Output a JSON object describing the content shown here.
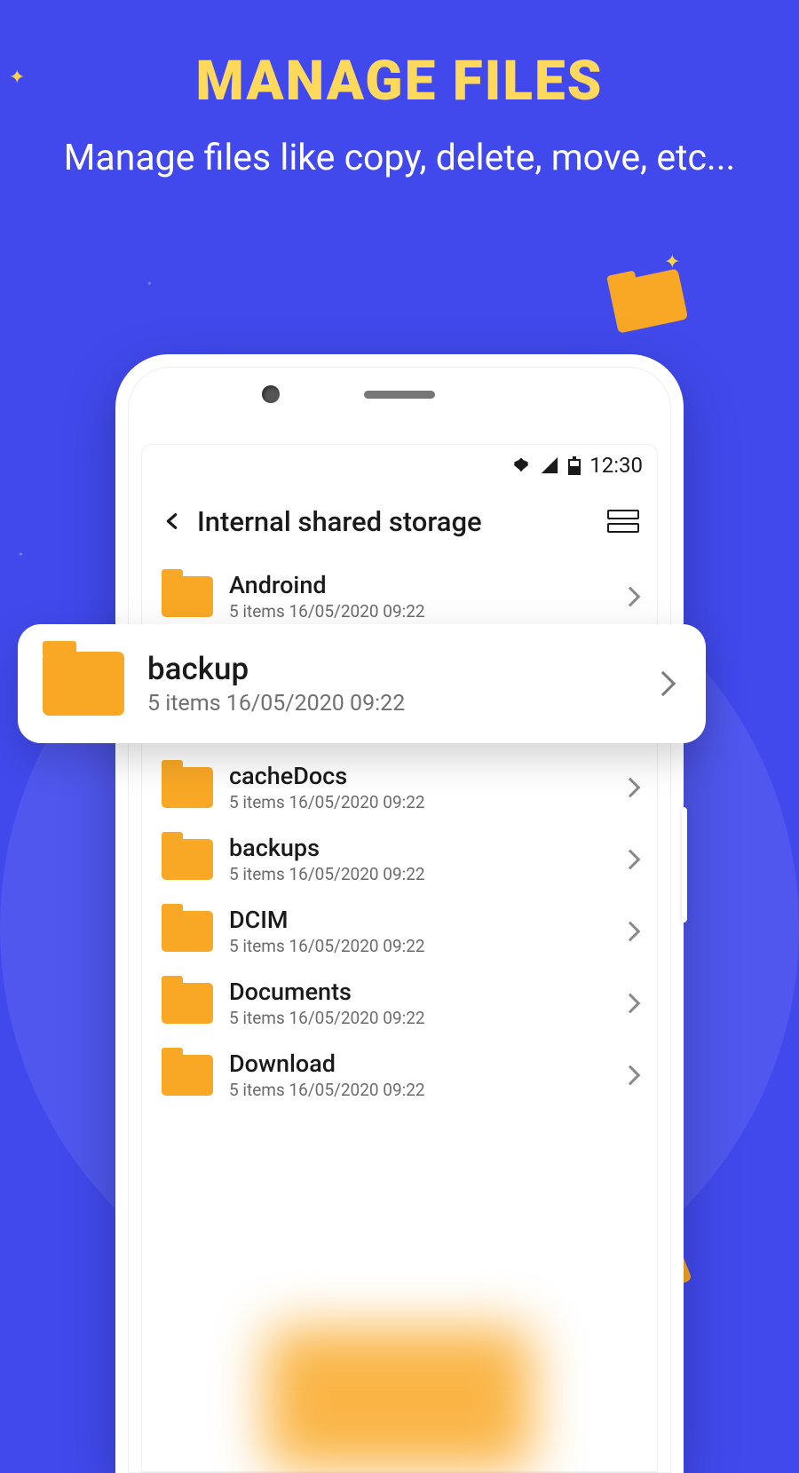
{
  "promo": {
    "title": "MANAGE FILES",
    "subtitle": "Manage files like copy, delete, move, etc..."
  },
  "status": {
    "time": "12:30"
  },
  "header": {
    "title": "Internal shared storage"
  },
  "highlighted_index": 1,
  "folders": [
    {
      "name": "Androind",
      "meta": "5 items 16/05/2020 09:22"
    },
    {
      "name": "backup",
      "meta": "5 items 16/05/2020 09:22"
    },
    {
      "name": "cacheDocs",
      "meta": "5 items 16/05/2020 09:22"
    },
    {
      "name": "backups",
      "meta": "5 items 16/05/2020 09:22"
    },
    {
      "name": "DCIM",
      "meta": "5 items 16/05/2020 09:22"
    },
    {
      "name": "Documents",
      "meta": "5 items 16/05/2020 09:22"
    },
    {
      "name": "Download",
      "meta": "5 items 16/05/2020 09:22"
    }
  ]
}
